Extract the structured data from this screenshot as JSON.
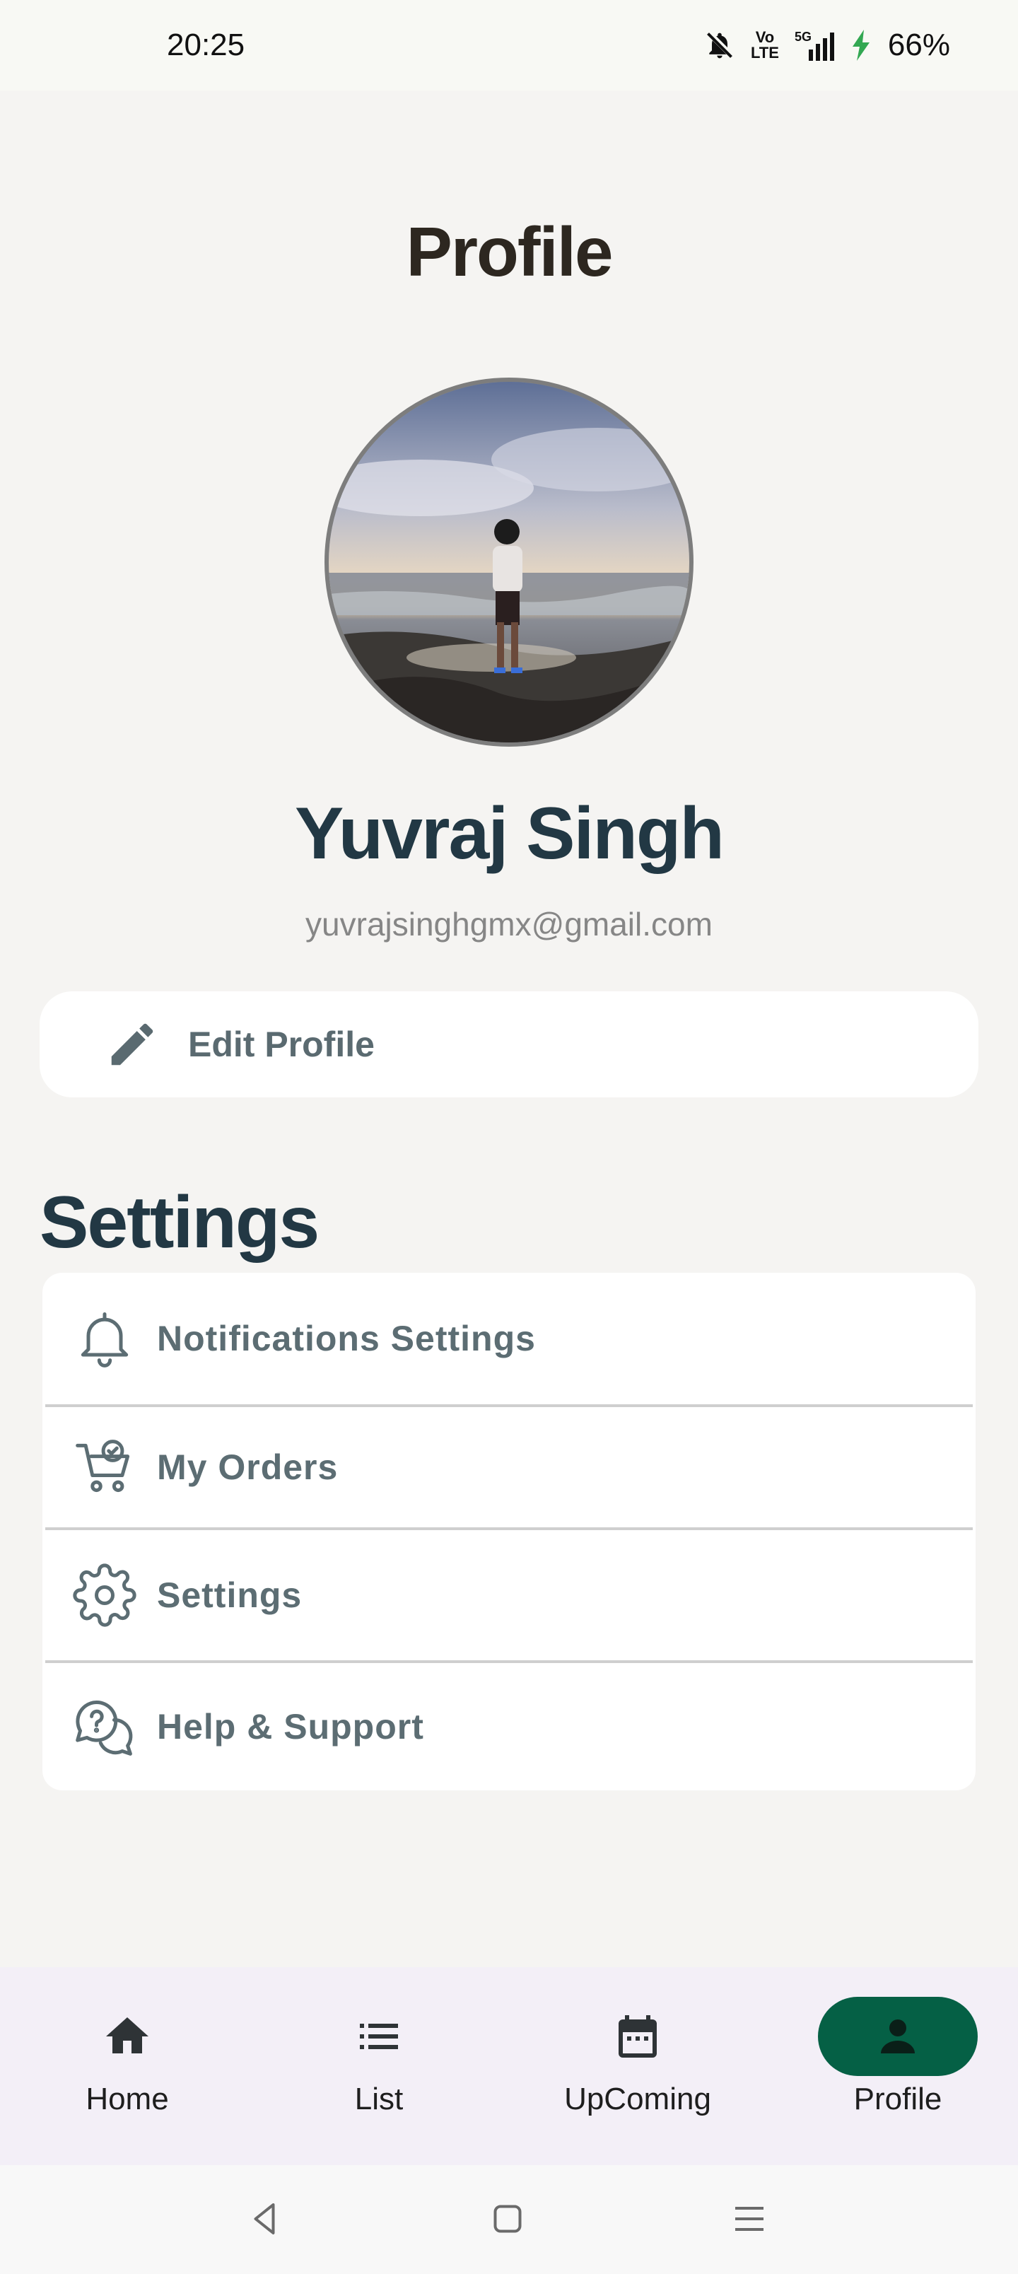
{
  "status_bar": {
    "time": "20:25",
    "battery": "66%",
    "network": "5G",
    "volte_top": "Vo",
    "volte_bottom": "LTE"
  },
  "page": {
    "title": "Profile"
  },
  "profile": {
    "name": "Yuvraj Singh",
    "email": "yuvrajsinghgmx@gmail.com",
    "edit_label": "Edit Profile"
  },
  "settings": {
    "heading": "Settings",
    "items": [
      {
        "label": "Notifications Settings",
        "icon": "bell-icon"
      },
      {
        "label": "My Orders",
        "icon": "cart-check-icon"
      },
      {
        "label": "Settings",
        "icon": "gear-icon"
      },
      {
        "label": "Help & Support",
        "icon": "help-chat-icon"
      }
    ]
  },
  "bottom_nav": {
    "items": [
      {
        "label": "Home",
        "icon": "home-icon"
      },
      {
        "label": "List",
        "icon": "list-icon"
      },
      {
        "label": "UpComing",
        "icon": "calendar-icon"
      },
      {
        "label": "Profile",
        "icon": "person-icon",
        "active": true
      }
    ],
    "active_color": "#056045"
  },
  "colors": {
    "background": "#f5f4f2",
    "heading": "#223844",
    "accent": "#056045"
  }
}
